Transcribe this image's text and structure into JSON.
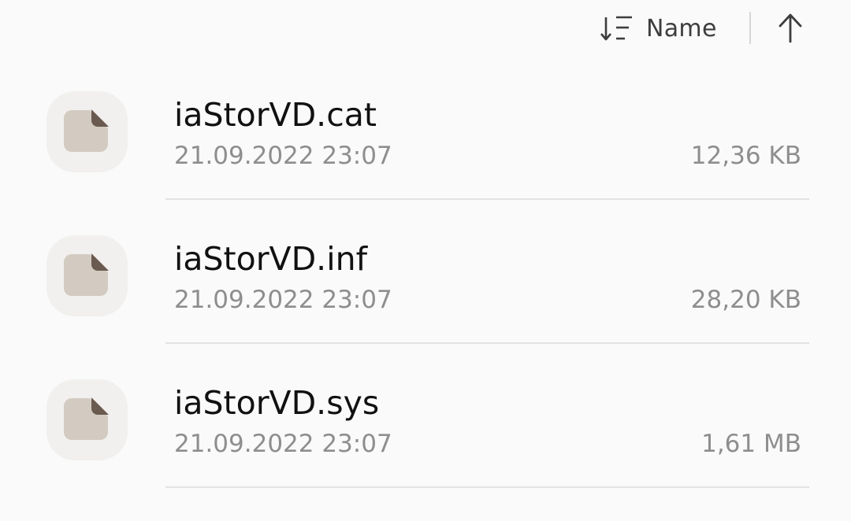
{
  "sort_bar": {
    "sort_label": "Name",
    "sort_icon": "sort-lines-icon",
    "order_icon": "arrow-up-icon"
  },
  "files": [
    {
      "name": "iaStorVD.cat",
      "date": "21.09.2022 23:07",
      "size": "12,36 KB",
      "icon": "document-icon"
    },
    {
      "name": "iaStorVD.inf",
      "date": "21.09.2022 23:07",
      "size": "28,20 KB",
      "icon": "document-icon"
    },
    {
      "name": "iaStorVD.sys",
      "date": "21.09.2022 23:07",
      "size": "1,61 MB",
      "icon": "document-icon"
    }
  ],
  "colors": {
    "background": "#fafafa",
    "icon_background": "#f1f0ef",
    "document_body": "#d3cbc1",
    "document_fold": "#6b5a4f"
  }
}
